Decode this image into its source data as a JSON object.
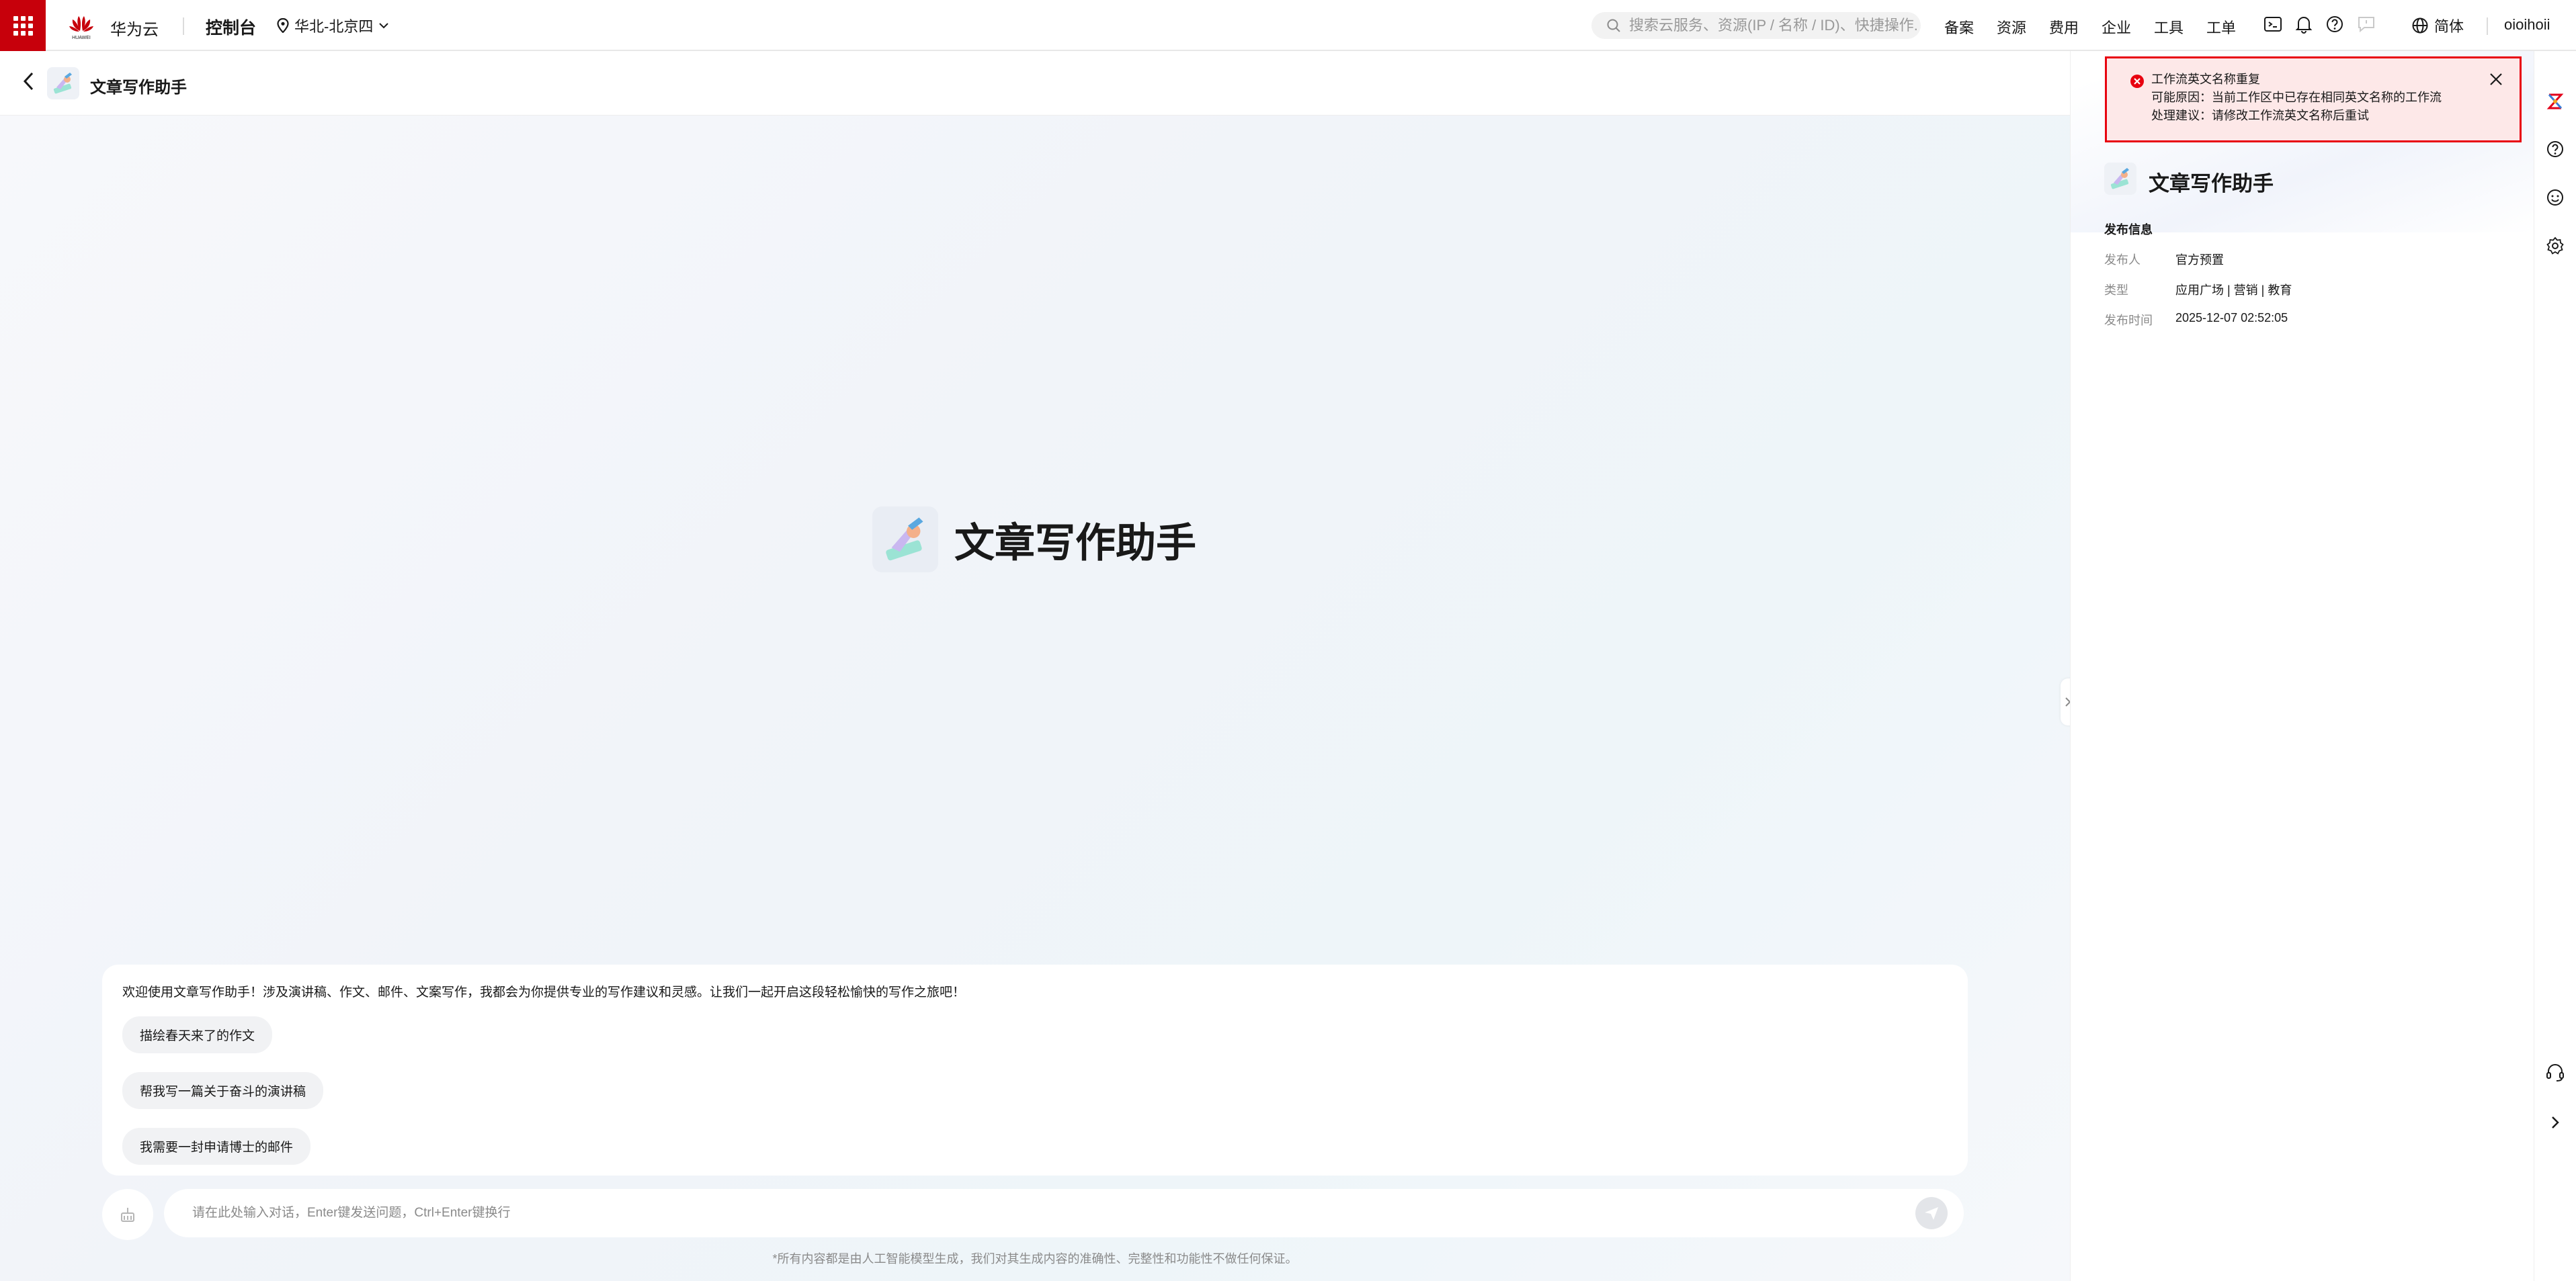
{
  "topbar": {
    "brand": "华为云",
    "logo_text": "HUAWEI",
    "console": "控制台",
    "region": "华北-北京四",
    "search_placeholder": "搜索云服务、资源(IP / 名称 / ID)、快捷操作...",
    "nav": [
      "备案",
      "资源",
      "费用",
      "企业",
      "工具",
      "工单"
    ],
    "language": "简体",
    "username": "oioihoii"
  },
  "page": {
    "title": "文章写作助手"
  },
  "hero": {
    "title": "文章写作助手"
  },
  "welcome": {
    "text": "欢迎使用文章写作助手！涉及演讲稿、作文、邮件、文案写作，我都会为你提供专业的写作建议和灵感。让我们一起开启这段轻松愉快的写作之旅吧！",
    "suggestions": [
      "描绘春天来了的作文",
      "帮我写一篇关于奋斗的演讲稿",
      "我需要一封申请博士的邮件"
    ]
  },
  "composer": {
    "placeholder": "请在此处输入对话，Enter键发送问题，Ctrl+Enter键换行"
  },
  "disclaimer": "*所有内容都是由人工智能模型生成，我们对其生成内容的准确性、完整性和功能性不做任何保证。",
  "panel": {
    "title": "文章写作助手",
    "section": "发布信息",
    "publisher_label": "发布人",
    "publisher": "官方预置",
    "type_label": "类型",
    "type": "应用广场 | 营销 | 教育",
    "time_label": "发布时间",
    "time": "2025-12-07 02:52:05"
  },
  "toast": {
    "title": "工作流英文名称重复",
    "reason": "可能原因：当前工作区中已存在相同英文名称的工作流",
    "suggestion": "处理建议：请修改工作流英文名称后重试"
  },
  "colors": {
    "brand_red": "#c7000b",
    "error_red": "#e8000f",
    "toast_bg": "#fde8e8"
  }
}
